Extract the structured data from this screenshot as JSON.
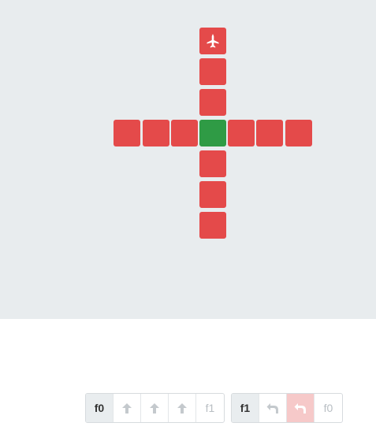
{
  "board": {
    "columns": 13,
    "rows": 10,
    "tiles": [
      {
        "col": 5,
        "row": 0,
        "color": "red",
        "icon": "plane-icon"
      },
      {
        "col": 5,
        "row": 1,
        "color": "red"
      },
      {
        "col": 5,
        "row": 2,
        "color": "red"
      },
      {
        "col": 2,
        "row": 3,
        "color": "red"
      },
      {
        "col": 3,
        "row": 3,
        "color": "red"
      },
      {
        "col": 4,
        "row": 3,
        "color": "red"
      },
      {
        "col": 5,
        "row": 3,
        "color": "green"
      },
      {
        "col": 6,
        "row": 3,
        "color": "red"
      },
      {
        "col": 7,
        "row": 3,
        "color": "red"
      },
      {
        "col": 8,
        "row": 3,
        "color": "red"
      },
      {
        "col": 5,
        "row": 4,
        "color": "red"
      },
      {
        "col": 5,
        "row": 5,
        "color": "red"
      },
      {
        "col": 5,
        "row": 6,
        "color": "red"
      }
    ]
  },
  "colors": {
    "red": "#e44a4a",
    "green": "#2f9b45",
    "board_bg": "#e8ecee"
  },
  "functions": [
    {
      "label": "f0",
      "slots": [
        {
          "type": "icon",
          "icon": "forward-arrow-icon"
        },
        {
          "type": "icon",
          "icon": "forward-arrow-icon"
        },
        {
          "type": "icon",
          "icon": "forward-arrow-icon"
        },
        {
          "type": "text",
          "text": "f1"
        }
      ]
    },
    {
      "label": "f1",
      "slots": [
        {
          "type": "icon",
          "icon": "turn-left-icon"
        },
        {
          "type": "icon",
          "icon": "turn-left-icon",
          "active": true
        },
        {
          "type": "text",
          "text": "f0"
        }
      ]
    }
  ]
}
